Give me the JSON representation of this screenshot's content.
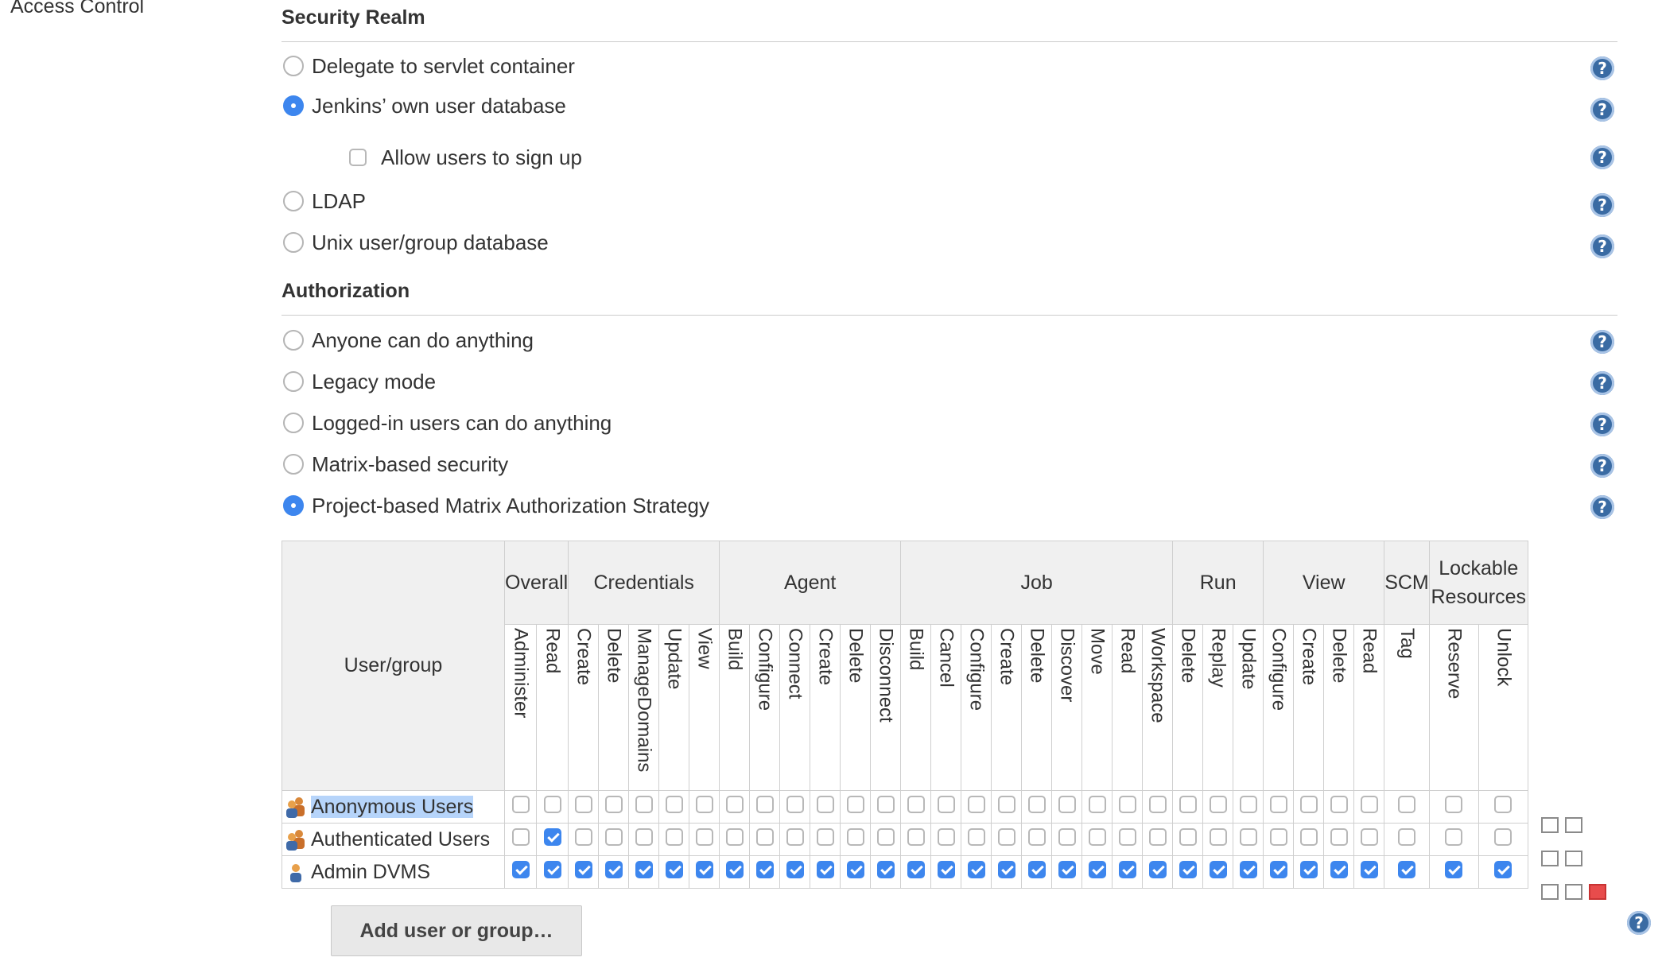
{
  "page": {
    "side_label": "Access Control"
  },
  "security_realm": {
    "heading": "Security Realm",
    "options": [
      {
        "label": "Delegate to servlet container",
        "selected": false
      },
      {
        "label": "Jenkins’ own user database",
        "selected": true
      },
      {
        "label": "LDAP",
        "selected": false
      },
      {
        "label": "Unix user/group database",
        "selected": false
      }
    ],
    "allow_signup": {
      "label": "Allow users to sign up",
      "checked": false
    }
  },
  "authorization": {
    "heading": "Authorization",
    "options": [
      {
        "label": "Anyone can do anything",
        "selected": false
      },
      {
        "label": "Legacy mode",
        "selected": false
      },
      {
        "label": "Logged-in users can do anything",
        "selected": false
      },
      {
        "label": "Matrix-based security",
        "selected": false
      },
      {
        "label": "Project-based Matrix Authorization Strategy",
        "selected": true
      }
    ]
  },
  "matrix": {
    "user_group_header": "User/group",
    "groups": [
      {
        "name": "Overall",
        "perms": [
          "Administer",
          "Read"
        ]
      },
      {
        "name": "Credentials",
        "perms": [
          "Create",
          "Delete",
          "ManageDomains",
          "Update",
          "View"
        ]
      },
      {
        "name": "Agent",
        "perms": [
          "Build",
          "Configure",
          "Connect",
          "Create",
          "Delete",
          "Disconnect"
        ]
      },
      {
        "name": "Job",
        "perms": [
          "Build",
          "Cancel",
          "Configure",
          "Create",
          "Delete",
          "Discover",
          "Move",
          "Read",
          "Workspace"
        ]
      },
      {
        "name": "Run",
        "perms": [
          "Delete",
          "Replay",
          "Update"
        ]
      },
      {
        "name": "View",
        "perms": [
          "Configure",
          "Create",
          "Delete",
          "Read"
        ]
      },
      {
        "name": "SCM",
        "perms": [
          "Tag"
        ]
      },
      {
        "name": "Lockable Resources",
        "perms": [
          "Reserve",
          "Unlock"
        ]
      }
    ],
    "rows": [
      {
        "name": "Anonymous Users",
        "type": "group",
        "highlighted": true,
        "deletable": false,
        "checked": [
          0,
          0,
          0,
          0,
          0,
          0,
          0,
          0,
          0,
          0,
          0,
          0,
          0,
          0,
          0,
          0,
          0,
          0,
          0,
          0,
          0,
          0,
          0,
          0,
          0,
          0,
          0,
          0,
          0,
          0,
          0,
          0
        ]
      },
      {
        "name": "Authenticated Users",
        "type": "group",
        "highlighted": false,
        "deletable": false,
        "checked": [
          0,
          1,
          0,
          0,
          0,
          0,
          0,
          0,
          0,
          0,
          0,
          0,
          0,
          0,
          0,
          0,
          0,
          0,
          0,
          0,
          0,
          0,
          0,
          0,
          0,
          0,
          0,
          0,
          0,
          0,
          0,
          0
        ]
      },
      {
        "name": "Admin DVMS",
        "type": "user",
        "highlighted": false,
        "deletable": true,
        "checked": [
          1,
          1,
          1,
          1,
          1,
          1,
          1,
          1,
          1,
          1,
          1,
          1,
          1,
          1,
          1,
          1,
          1,
          1,
          1,
          1,
          1,
          1,
          1,
          1,
          1,
          1,
          1,
          1,
          1,
          1,
          1,
          1
        ]
      }
    ],
    "add_button_label": "Add user or group…"
  },
  "icons": {
    "help": "help-icon",
    "group": "group-icon",
    "user": "user-icon",
    "select_all": "select-all-icon",
    "unselect_all": "unselect-all-icon",
    "remove": "remove-icon"
  },
  "colors": {
    "accent": "#3d86ee",
    "help": "#3a6ba3",
    "highlight": "#b6d4fa",
    "remove": "#e84c4c"
  }
}
